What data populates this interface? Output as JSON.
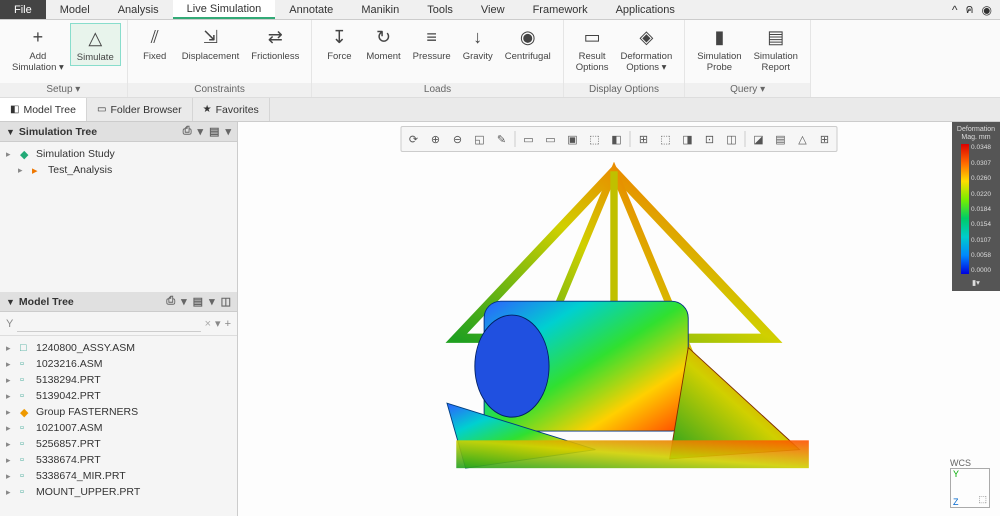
{
  "menubar": {
    "items": [
      "File",
      "Model",
      "Analysis",
      "Live Simulation",
      "Annotate",
      "Manikin",
      "Tools",
      "View",
      "Framework",
      "Applications"
    ],
    "active_index": 3
  },
  "ribbon": {
    "groups": [
      {
        "label": "Setup ▾",
        "items": [
          {
            "id": "add-sim",
            "label": "Add\nSimulation ▾",
            "icon": "+"
          },
          {
            "id": "simulate",
            "label": "Simulate",
            "icon": "△",
            "highlighted": true
          }
        ]
      },
      {
        "label": "Constraints",
        "items": [
          {
            "id": "fixed",
            "label": "Fixed",
            "icon": "⫽"
          },
          {
            "id": "disp",
            "label": "Displacement",
            "icon": "⇲"
          },
          {
            "id": "frictionless",
            "label": "Frictionless",
            "icon": "⇄"
          }
        ]
      },
      {
        "label": "Loads",
        "items": [
          {
            "id": "force",
            "label": "Force",
            "icon": "↧"
          },
          {
            "id": "moment",
            "label": "Moment",
            "icon": "↻"
          },
          {
            "id": "pressure",
            "label": "Pressure",
            "icon": "≡"
          },
          {
            "id": "gravity",
            "label": "Gravity",
            "icon": "↓"
          },
          {
            "id": "centrifugal",
            "label": "Centrifugal",
            "icon": "◉"
          }
        ]
      },
      {
        "label": "Display Options",
        "items": [
          {
            "id": "result-opts",
            "label": "Result\nOptions",
            "icon": "▭"
          },
          {
            "id": "deform-opts",
            "label": "Deformation\nOptions ▾",
            "icon": "◈"
          }
        ]
      },
      {
        "label": "Query ▾",
        "items": [
          {
            "id": "sim-probe",
            "label": "Simulation\nProbe",
            "icon": "▮"
          },
          {
            "id": "sim-report",
            "label": "Simulation\nReport",
            "icon": "▤"
          }
        ]
      }
    ]
  },
  "browser_tabs": [
    {
      "icon": "◧",
      "label": "Model Tree",
      "active": true
    },
    {
      "icon": "▭",
      "label": "Folder Browser"
    },
    {
      "icon": "★",
      "label": "Favorites"
    }
  ],
  "sim_panel": {
    "title": "Simulation Tree",
    "items": [
      {
        "icon": "◆",
        "label": "Simulation Study",
        "color": "#2a7"
      },
      {
        "icon": "▸",
        "label": "Test_Analysis",
        "indent": 1,
        "exp": "▸",
        "iconColor": "#e70"
      }
    ]
  },
  "model_panel": {
    "title": "Model Tree",
    "items": [
      {
        "icon": "□",
        "label": "1240800_ASSY.ASM",
        "color": "#4a9"
      },
      {
        "icon": "▫",
        "label": "1023216.ASM",
        "color": "#4a9"
      },
      {
        "icon": "▫",
        "label": "5138294.PRT",
        "color": "#4a9"
      },
      {
        "icon": "▫",
        "label": "5139042.PRT",
        "color": "#4a9"
      },
      {
        "icon": "◆",
        "label": "Group FASTERNERS",
        "color": "#e90"
      },
      {
        "icon": "▫",
        "label": "1021007.ASM",
        "color": "#4a9"
      },
      {
        "icon": "▫",
        "label": "5256857.PRT",
        "color": "#4a9"
      },
      {
        "icon": "▫",
        "label": "5338674.PRT",
        "color": "#4a9"
      },
      {
        "icon": "▫",
        "label": "5338674_MIR.PRT",
        "color": "#4a9"
      },
      {
        "icon": "▫",
        "label": "MOUNT_UPPER.PRT",
        "color": "#4a9"
      }
    ]
  },
  "filter": {
    "placeholder": ""
  },
  "legend": {
    "title": "Deformation Mag.\nmm",
    "ticks": [
      "0.0348",
      "0.0307",
      "0.0260",
      "0.0220",
      "0.0184",
      "0.0154",
      "0.0107",
      "0.0058",
      "0.0000"
    ]
  },
  "wcs": {
    "label": "WCS",
    "axes": [
      "Y",
      "Z"
    ]
  },
  "canvas_toolbar": [
    "⟳",
    "⊕",
    "⊖",
    "◱",
    "✎",
    "▭",
    "▭",
    "▣",
    "⬚",
    "◧",
    "⊞",
    "⬚",
    "◨",
    "⊡",
    "◫",
    "◪",
    "▤",
    "△",
    "⊞"
  ]
}
